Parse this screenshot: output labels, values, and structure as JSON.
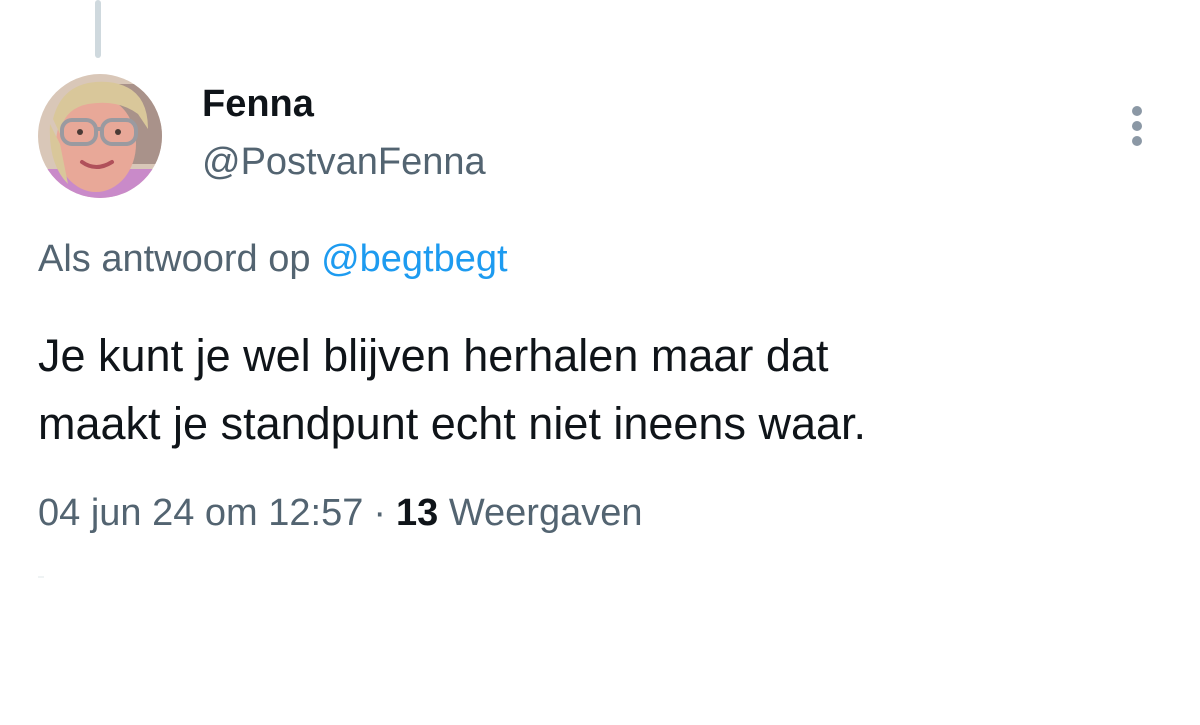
{
  "tweet": {
    "author": {
      "display_name": "Fenna",
      "handle": "@PostvanFenna"
    },
    "reply_to": {
      "prefix": "Als antwoord op",
      "mention": "@begtbegt"
    },
    "text_line1": "Je kunt je wel blijven herhalen maar dat",
    "text_line2": "maakt je standpunt echt niet ineens waar.",
    "timestamp": "04 jun 24 om 12:57",
    "separator": "·",
    "views_count": "13",
    "views_label": "Weergaven"
  },
  "icons": {
    "more": "more-vertical-icon"
  },
  "colors": {
    "text_primary": "#0f1419",
    "text_secondary": "#536471",
    "link": "#1d9bf0",
    "thread_line": "#cfd9de"
  }
}
